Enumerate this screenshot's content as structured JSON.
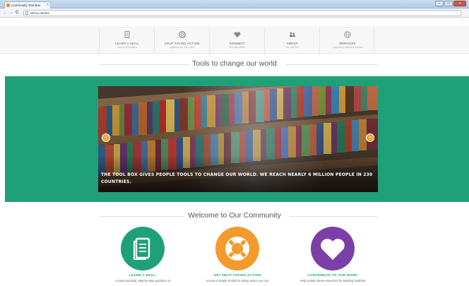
{
  "browser": {
    "tab_title": "Community Tool Box",
    "tab_close": "×",
    "url": "ctb.ku.edu/en",
    "nav": {
      "back": "←",
      "forward": "→",
      "reload": "C"
    },
    "window": {
      "minimize": "–",
      "maximize": "□",
      "close": "×"
    }
  },
  "topnav": {
    "items": [
      {
        "title": "LEARN A SKILL",
        "subtitle": "how-to information",
        "icon": "document-icon"
      },
      {
        "title": "HELP TAKING ACTION",
        "subtitle": "guidance for your work",
        "icon": "life-ring-icon"
      },
      {
        "title": "CONNECT",
        "subtitle": "link with others",
        "icon": "heart-icon"
      },
      {
        "title": "ABOUT",
        "subtitle": "the tool box",
        "icon": "people-icon"
      },
      {
        "title": "SERVICES",
        "subtitle": "supporting collective impact",
        "icon": "globe-icon"
      }
    ]
  },
  "hero": {
    "heading": "Tools to change our world",
    "caption": "THE TOOL BOX GIVES PEOPLE TOOLS TO CHANGE OUR WORLD. WE REACH NEARLY 6 MILLION PEOPLE IN 230 COUNTRIES.",
    "prev_arrow": "‹",
    "next_arrow": "›"
  },
  "community": {
    "heading": "Welcome to Our Community",
    "features": [
      {
        "title": "LEARN A SKILL",
        "desc": "Access practical, step-by-step guidance in",
        "color": "#1fa079",
        "icon": "document-icon"
      },
      {
        "title": "GET HELP TAKING ACTION",
        "desc": "Access a simple model for taking action you can",
        "color": "#f39a2c",
        "icon": "life-ring-icon"
      },
      {
        "title": "CONTRIBUTE TO OUR WORK",
        "desc": "Help sustain these resources for building healthier",
        "color": "#7b3fa8",
        "icon": "heart-icon"
      }
    ]
  },
  "colors": {
    "green": "#1fa079",
    "orange": "#f39a2c",
    "purple": "#7b3fa8"
  }
}
